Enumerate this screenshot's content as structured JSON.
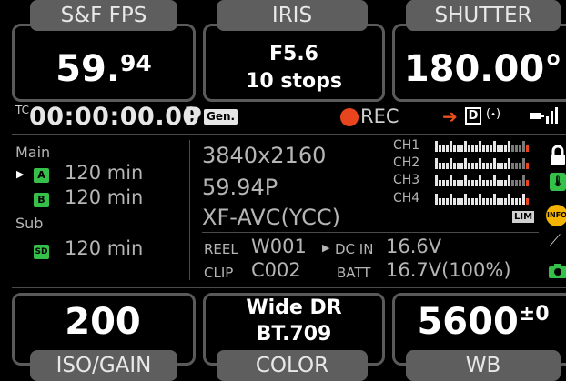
{
  "top": {
    "fps": {
      "label": "S&F FPS",
      "value_main": "59.",
      "value_frac": "94"
    },
    "iris": {
      "label": "IRIS",
      "line1": "F5.6",
      "line2": "10 stops"
    },
    "shutter": {
      "label": "SHUTTER",
      "value": "180.00°"
    }
  },
  "timecode": {
    "prefix": "TC",
    "value": "00:00:00.00",
    "mode": "P",
    "gen": "Gen.",
    "rec": "REC"
  },
  "media": {
    "main_label": "Main",
    "slot_a": {
      "badge": "A",
      "remaining": "120 min"
    },
    "slot_b": {
      "badge": "B",
      "remaining": "120 min"
    },
    "sub_label": "Sub",
    "slot_sd": {
      "badge": "SD",
      "remaining": "120 min"
    }
  },
  "format": {
    "resolution": "3840x2160",
    "frame_rate": "59.94P",
    "codec": "XF-AVC(YCC)"
  },
  "audio": {
    "channels": [
      "CH1",
      "CH2",
      "CH3",
      "CH4"
    ],
    "limiter": "LIM"
  },
  "info": {
    "reel_label": "REEL",
    "reel_value": "W001",
    "clip_label": "CLIP",
    "clip_value": "C002",
    "dcin_label": "DC IN",
    "dcin_value": "16.6V",
    "batt_label": "BATT",
    "batt_value": "16.7V(100%)"
  },
  "bottom": {
    "iso": {
      "label": "ISO/GAIN",
      "value": "200"
    },
    "color": {
      "label": "COLOR",
      "line1": "Wide DR",
      "line2": "BT.709"
    },
    "wb": {
      "label": "WB",
      "value": "5600",
      "offset": "±0"
    }
  },
  "colors": {
    "rec": "#e8451e",
    "slot": "#35c04a",
    "arrow": "#e8501e",
    "info_badge": "#f2b400"
  },
  "icons": [
    "play-arrow-icon",
    "wireless-icon",
    "lock-icon",
    "thermometer-icon",
    "info-icon",
    "satellite-icon",
    "camera-icon",
    "network-icon"
  ]
}
